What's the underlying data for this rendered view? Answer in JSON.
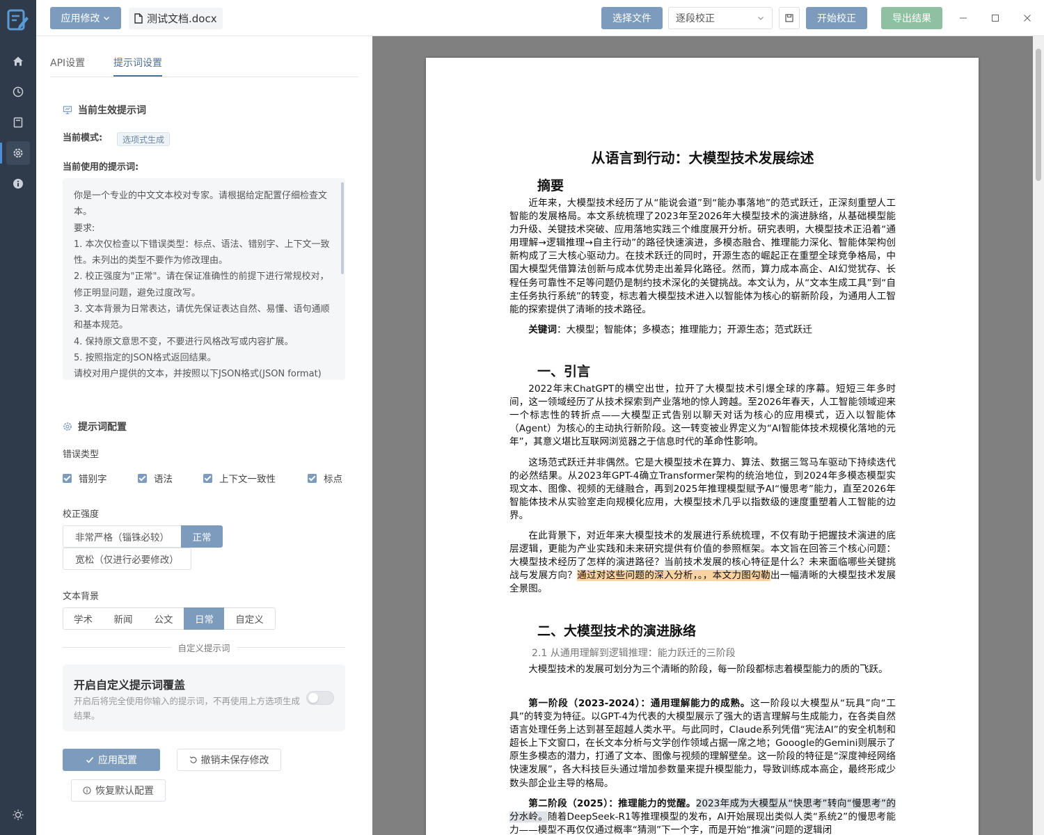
{
  "topbar": {
    "apply_menu": "应用修改",
    "file_name": "测试文档.docx",
    "choose_file": "选择文件",
    "mode_select": "逐段校正",
    "start": "开始校正",
    "export": "导出结果"
  },
  "sidebar": {
    "items": [
      "home-icon",
      "history-icon",
      "book-icon",
      "settings-icon",
      "info-icon"
    ],
    "active": "settings-icon",
    "bottom": "theme-sun-icon"
  },
  "panel": {
    "tabs": [
      "API设置",
      "提示词设置"
    ],
    "active_tab": "提示词设置",
    "current_title": "当前生效提示词",
    "mode_label": "当前模式:",
    "mode_tag": "选项式生成",
    "prompt_label": "当前使用的提示词:",
    "prompt_lines": [
      "你是一个专业的中文文本校对专家。请根据给定配置仔细检查文本。",
      "要求:",
      "1. 本次仅检查以下错误类型：标点、语法、错别字、上下文一致性。未列出的类型不要作为修改理由。",
      "2. 校正强度为\"正常\"。请在保证准确性的前提下进行常规校对，修正明显问题，避免过度改写。",
      "3. 文本背景为日常表达，请优先保证表达自然、易懂、语句通顺和基本规范。",
      "4. 保持原文意思不变，不要进行风格改写或内容扩展。",
      "5. 按照指定的JSON格式返回结果。",
      "请校对用户提供的文本，并按照以下JSON格式(JSON format)返"
    ],
    "config_title": "提示词配置",
    "error_types_label": "错误类型",
    "error_types": [
      "错别字",
      "语法",
      "上下文一致性",
      "标点"
    ],
    "strength_label": "校正强度",
    "strength_options": [
      "非常严格（锱铢必较）",
      "正常",
      "宽松（仅进行必要修改）"
    ],
    "strength_selected": "正常",
    "background_label": "文本背景",
    "background_options": [
      "学术",
      "新闻",
      "公文",
      "日常",
      "自定义"
    ],
    "background_selected": "日常",
    "custom_divider": "自定义提示词",
    "custom_title": "开启自定义提示词覆盖",
    "custom_desc": "开启后将完全使用你输入的提示词，不再使用上方选项生成结果。",
    "custom_enabled": false,
    "apply_button": "应用配置",
    "revert_button": "撤销未保存修改",
    "restore_button": "恢复默认配置"
  },
  "document": {
    "title": "从语言到行动：大模型技术发展综述",
    "abstract_heading": "摘要",
    "abstract": "近年来，大模型技术经历了从“能说会道”到“能办事落地”的范式跃迁，正深刻重塑人工智能的发展格局。本文系统梳理了2023年至2026年大模型技术的演进脉络，从基础模型能力升级、关键技术突破、应用落地实践三个维度展开分析。研究表明，大模型技术正沿着“通用理解→逻辑推理→自主行动”的路径快速演进，多模态融合、推理能力深化、智能体架构创新构成了三大核心驱动力。在技术跃迁的同时，开源生态的崛起正在重塑全球竞争格局，中国大模型凭借算法创新与成本优势走出差异化路径。然而，算力成本高企、AI幻觉犹存、长程任务可靠性不足等问题仍是制约技术深化的关键挑战。本文认为，从“文本生成工具”到“自主任务执行系统”的转变，标志着大模型技术进入以智能体为核心的崭新阶段，为通用人工智能的探索提供了清晰的技术路径。",
    "keywords_label": "关键词",
    "keywords": "大模型；智能体；多模态；推理能力；开源生态；范式跃迁",
    "section1_heading": "一、引言",
    "s1_p1": "2022年末ChatGPT的横空出世，拉开了大模型技术引爆全球的序幕。短短三年多时间，这一领域经历了从技术探索到产业落地的惊人跨越。至2026年春天，人工智能领域迎来一个标志性的转折点——大模型正式告别以聊天对话为核心的应用模式，迈入以智能体（Agent）为核心的主动执行新阶段。这一转变被业界定义为“AI智能体技术规模化落地的元年”，其意义堪比互联网浏览器之于信息时代的",
    "s1_p1_end": "革命性影响",
    "s1_p2": "这场范式跃迁并非偶然。它是大模型技术在算力、算法、数据三驾马车驱动下持续迭代的必然结果。从2023年GPT-4确立Transformer架构的统治地位，到2024年多模态模型实现文本、图像、视频的无缝融合，再到2025年推理模型赋予AI“慢思考”能力，直至2026年智能体技术从实验室走向规模化应用，大模型技术几乎以指数级的速度重塑着人工智能的边界。",
    "s1_p3_a": "在此背景下，对近年来大模型技术的发展进行系统梳理，不仅有助于把握技术演进的底层逻辑，更能为产业实践和未来研究提供有价值的参照框架。本文旨在回答三个核心问题：大模型技术经历了怎样的演进路径？当前技术发展的核心特征是什么？未来面临哪些关键挑战与发展方向？",
    "s1_p3_hl": "通过对这些问题的深入分析，。，本文力图勾勒",
    "s1_p3_b": "出一幅清晰的大模型技术发展全景图。",
    "section2_heading": "二、大模型技术的演进脉络",
    "s2_sub": "2.1 从通用理解到逻辑推理：能力跃迁的三阶段",
    "s2_p1": "大模型技术的发展可划分为三个清晰的阶段，每一阶段都标志着模型能力的质的飞跃。",
    "s2_p2_lead": "第一阶段（2023-2024）：通用理解能力的成熟。",
    "s2_p2": "这一阶段以大模型从“玩具”向“工具”的转变为特征。以GPT-4为代表的大模型展示了强大的语言理解与生成能力，在各类自然语言处理任务上达到甚至超越人类水平。与此同时，Claude系列凭借“宪法AI”的安全机制和超长上下文窗口，在长文本分析与文学创作领域占据一席之地；Gooogle的Gemini则展示了原生多模态的潜力，打通了文本、图像与视频的理解壁垒。这一阶段的特征是“深度神经网络快速发展”，各大科技巨头通过增加参数量来提升模型能力，导致训练成本高企，最终形成少数头部企业主导的格局。",
    "s2_p3_lead": "第二阶段（2025）：推理能力的觉醒。",
    "s2_p3_hl": "2023年成为大模型从“快思考”转向“慢思考”的分水岭。",
    "s2_p3": "随着DeepSeek-R1等推理模型的发布，AI开始展现出类似人类“系统2”的慢思考能力——模型不再仅仅通过概率“猜测”下一个字，而是开始“推演”问题的逻辑闭"
  },
  "colors": {
    "accent": "#7d9cbd",
    "rail": "#2f3a4a",
    "highlight": "#f9d3a0",
    "export": "#8fc0a2"
  }
}
